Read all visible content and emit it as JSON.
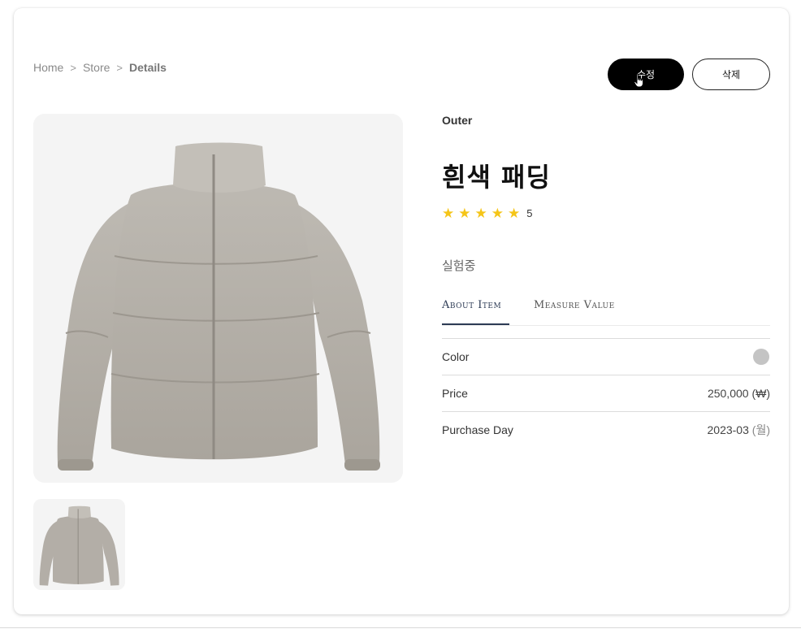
{
  "breadcrumb": {
    "home": "Home",
    "store": "Store",
    "current": "Details",
    "separator": ">"
  },
  "actions": {
    "edit_label": "수정",
    "delete_label": "삭제"
  },
  "product": {
    "category": "Outer",
    "title": "흰색 패딩",
    "rating": {
      "stars": 5,
      "max": 5,
      "label": "5"
    },
    "description": "실험중",
    "tabs": [
      {
        "label": "About Item",
        "active": true
      },
      {
        "label": "Measure Value",
        "active": false
      }
    ],
    "specs": {
      "color_label": "Color",
      "color_value": "#c4c4c4",
      "price_label": "Price",
      "price_value": "250,000",
      "price_unit": "(₩)",
      "purchase_label": "Purchase Day",
      "purchase_value": "2023-03",
      "purchase_unit": "(월)"
    }
  },
  "colors": {
    "accent": "#2d3b55",
    "star": "#f5c518",
    "button_primary": "#000000"
  },
  "icons": {
    "star": "star-icon",
    "cursor": "hand-pointer-icon",
    "separator": "chevron-right-icon"
  }
}
